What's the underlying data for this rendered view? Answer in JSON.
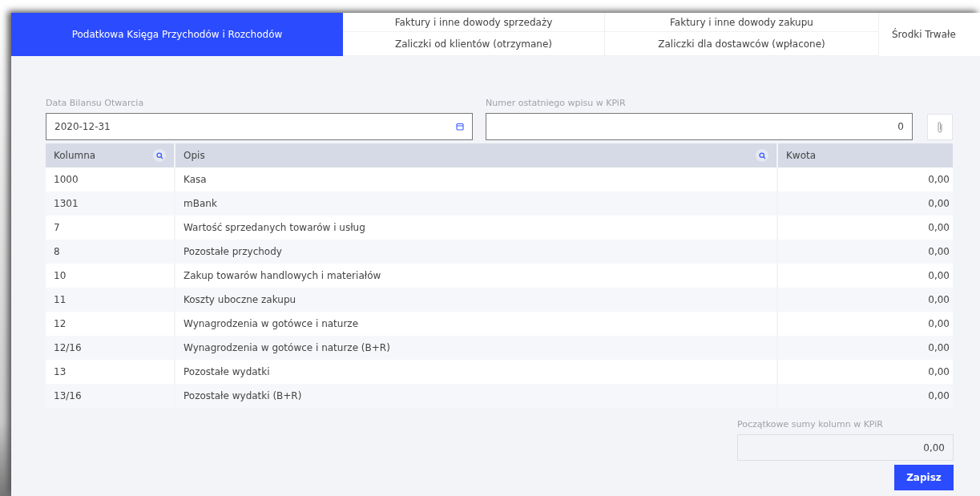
{
  "tabs": [
    {
      "label": "Podatkowa Księga Przychodów i Rozchodów",
      "selected": true
    },
    {
      "label": "Faktury i inne dowody sprzedaży",
      "selected": false
    },
    {
      "label": "Faktury i inne dowody zakupu",
      "selected": false
    },
    {
      "label": "Zaliczki od klientów (otrzymane)",
      "selected": false
    },
    {
      "label": "Zaliczki dla dostawców (wpłacone)",
      "selected": false
    },
    {
      "label": "Środki Trwałe",
      "selected": false
    }
  ],
  "date_field": {
    "label": "Data Bilansu Otwarcia",
    "value": "2020-12-31"
  },
  "number_field": {
    "label": "Numer ostatniego wpisu w KPiR",
    "value": "0"
  },
  "table": {
    "columns": [
      "Kolumna",
      "Opis",
      "Kwota"
    ],
    "rows": [
      {
        "kolumna": "1000",
        "opis": "Kasa",
        "kwota": "0,00"
      },
      {
        "kolumna": "1301",
        "opis": "mBank",
        "kwota": "0,00"
      },
      {
        "kolumna": "7",
        "opis": "Wartość sprzedanych towarów i usług",
        "kwota": "0,00"
      },
      {
        "kolumna": "8",
        "opis": "Pozostałe przychody",
        "kwota": "0,00"
      },
      {
        "kolumna": "10",
        "opis": "Zakup towarów handlowych i materiałów",
        "kwota": "0,00"
      },
      {
        "kolumna": "11",
        "opis": "Koszty uboczne zakupu",
        "kwota": "0,00"
      },
      {
        "kolumna": "12",
        "opis": "Wynagrodzenia w gotówce i naturze",
        "kwota": "0,00"
      },
      {
        "kolumna": "12/16",
        "opis": "Wynagrodzenia w gotówce i naturze (B+R)",
        "kwota": "0,00"
      },
      {
        "kolumna": "13",
        "opis": "Pozostałe wydatki",
        "kwota": "0,00"
      },
      {
        "kolumna": "13/16",
        "opis": "Pozostałe wydatki (B+R)",
        "kwota": "0,00"
      }
    ]
  },
  "totals_field": {
    "label": "Początkowe sumy kolumn w KPiR",
    "value": "0,00"
  },
  "save_button": "Zapisz"
}
